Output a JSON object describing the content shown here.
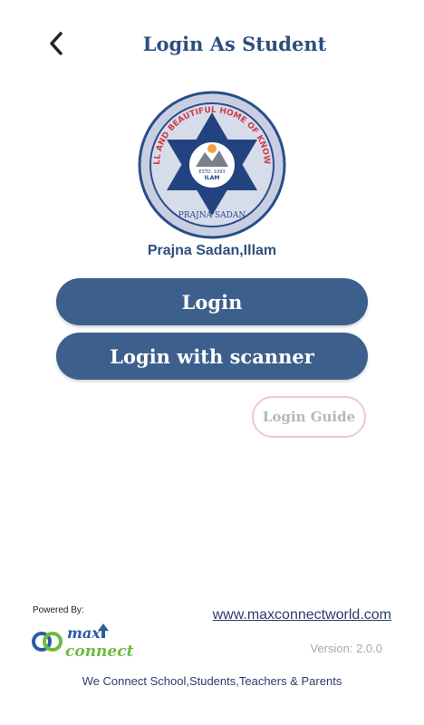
{
  "header": {
    "title": "Login As Student",
    "back_icon": "chevron-left-icon"
  },
  "school": {
    "name": "Prajna Sadan,Illam",
    "logo": {
      "outer_text": "A SMALL AND BEAUTIFUL HOME OF KNOWLEDGE",
      "banner_text": "PRAJNA SADAN",
      "estd_text": "ESTD. 1993",
      "center_text": "ILAM"
    }
  },
  "actions": {
    "login_label": "Login",
    "scanner_label": "Login with scanner",
    "guide_label": "Login Guide"
  },
  "footer": {
    "powered_by": "Powered By:",
    "brand_name_top": "max",
    "brand_name_bottom": "connect",
    "website": "www.maxconnectworld.com",
    "version": "Version: 2.0.0",
    "tagline": "We Connect School,Students,Teachers & Parents"
  },
  "colors": {
    "primary": "#3d5f8c",
    "title": "#2d4f7c",
    "guide_border": "#f1c9cf",
    "brand_green": "#6dbb3f",
    "brand_blue": "#2a5d9f"
  }
}
